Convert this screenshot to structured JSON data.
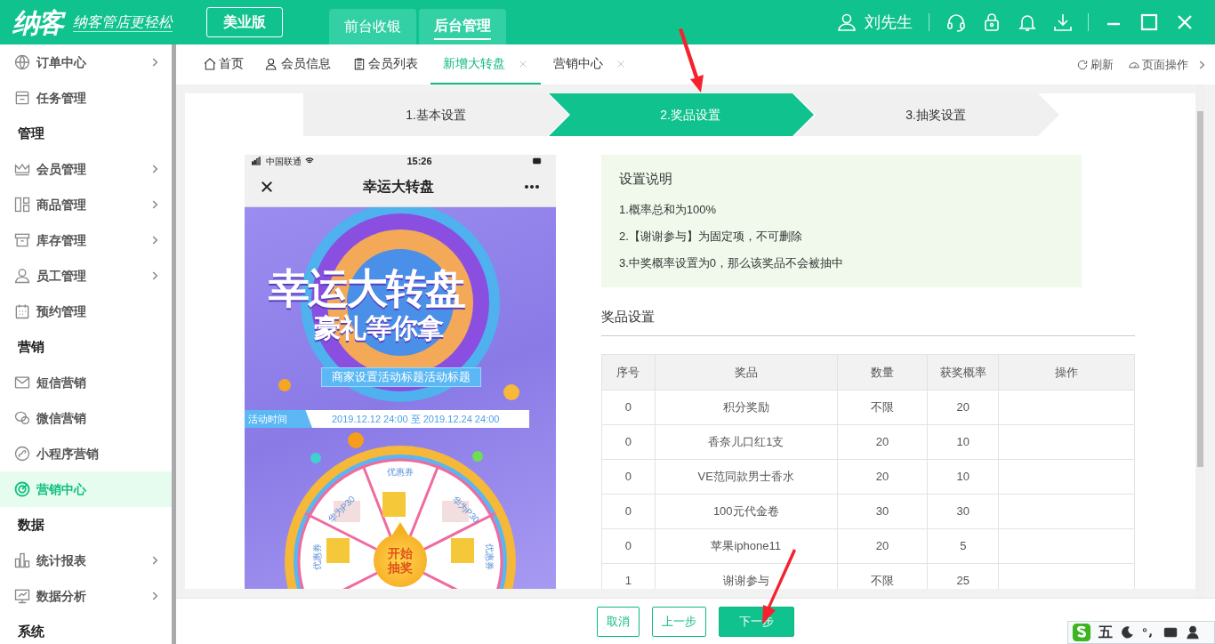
{
  "header": {
    "logo": "纳客",
    "slogan": "纳客管店更轻松",
    "edition": "美业版",
    "modes": [
      {
        "label": "前台收银",
        "selected": false
      },
      {
        "label": "后台管理",
        "selected": true
      }
    ],
    "user": "刘先生"
  },
  "sidebar": {
    "items": [
      {
        "kind": "item",
        "label": "订单中心",
        "expandable": true,
        "selected": false
      },
      {
        "kind": "item",
        "label": "任务管理",
        "expandable": false,
        "selected": false
      },
      {
        "kind": "header",
        "label": "管理"
      },
      {
        "kind": "item",
        "label": "会员管理",
        "expandable": true,
        "selected": false
      },
      {
        "kind": "item",
        "label": "商品管理",
        "expandable": true,
        "selected": false
      },
      {
        "kind": "item",
        "label": "库存管理",
        "expandable": true,
        "selected": false
      },
      {
        "kind": "item",
        "label": "员工管理",
        "expandable": true,
        "selected": false
      },
      {
        "kind": "item",
        "label": "预约管理",
        "expandable": false,
        "selected": false
      },
      {
        "kind": "header",
        "label": "营销"
      },
      {
        "kind": "item",
        "label": "短信营销",
        "expandable": false,
        "selected": false
      },
      {
        "kind": "item",
        "label": "微信营销",
        "expandable": false,
        "selected": false
      },
      {
        "kind": "item",
        "label": "小程序营销",
        "expandable": false,
        "selected": false
      },
      {
        "kind": "item",
        "label": "营销中心",
        "expandable": false,
        "selected": true
      },
      {
        "kind": "header",
        "label": "数据"
      },
      {
        "kind": "item",
        "label": "统计报表",
        "expandable": true,
        "selected": false
      },
      {
        "kind": "item",
        "label": "数据分析",
        "expandable": true,
        "selected": false
      },
      {
        "kind": "header",
        "label": "系统"
      }
    ]
  },
  "tabs": [
    {
      "label": "首页",
      "selected": false,
      "closable": false
    },
    {
      "label": "会员信息",
      "selected": false,
      "closable": false
    },
    {
      "label": "会员列表",
      "selected": false,
      "closable": false
    },
    {
      "label": "新增大转盘",
      "selected": true,
      "closable": true
    },
    {
      "label": "营销中心",
      "selected": false,
      "closable": true
    }
  ],
  "tab_tools": [
    "刷新",
    "页面操作"
  ],
  "steps": [
    {
      "label": "1.基本设置",
      "selected": false
    },
    {
      "label": "2.奖品设置",
      "selected": true
    },
    {
      "label": "3.抽奖设置",
      "selected": false
    }
  ],
  "preview": {
    "carrier": "中国联通",
    "time": "15:26",
    "title": "幸运大转盘",
    "poster_title": "幸运大转盘",
    "poster_subtitle": "豪礼等你拿",
    "banner": "商家设置活动标题活动标题",
    "time_label": "活动时间",
    "start": "2019.12.12 24:00",
    "separator": "至",
    "end": "2019.12.24 24:00",
    "wheel_labels": [
      "优惠券",
      "华为P30",
      "华为P30",
      "优惠券",
      "优惠券"
    ],
    "start_button": "开始抽奖"
  },
  "notice": {
    "title": "设置说明",
    "lines": [
      "1.概率总和为100%",
      "2.【谢谢参与】为固定项，不可删除",
      "3.中奖概率设置为0，那么该奖品不会被抽中"
    ]
  },
  "prizes": {
    "title": "奖品设置",
    "columns": [
      "序号",
      "奖品",
      "数量",
      "获奖概率",
      "操作"
    ],
    "rows": [
      [
        "0",
        "积分奖励",
        "不限",
        "20"
      ],
      [
        "0",
        "香奈儿口红1支",
        "20",
        "10"
      ],
      [
        "0",
        "VE范同款男士香水",
        "20",
        "10"
      ],
      [
        "0",
        "100元代金卷",
        "30",
        "30"
      ],
      [
        "0",
        "苹果iphone11",
        "20",
        "5"
      ],
      [
        "1",
        "谢谢参与",
        "不限",
        "25"
      ]
    ]
  },
  "buttons": [
    {
      "label": "取消",
      "kind": "outline"
    },
    {
      "label": "上一步",
      "kind": "outline"
    },
    {
      "label": "下一步",
      "kind": "primary"
    }
  ],
  "ime": {
    "mode": "五"
  }
}
